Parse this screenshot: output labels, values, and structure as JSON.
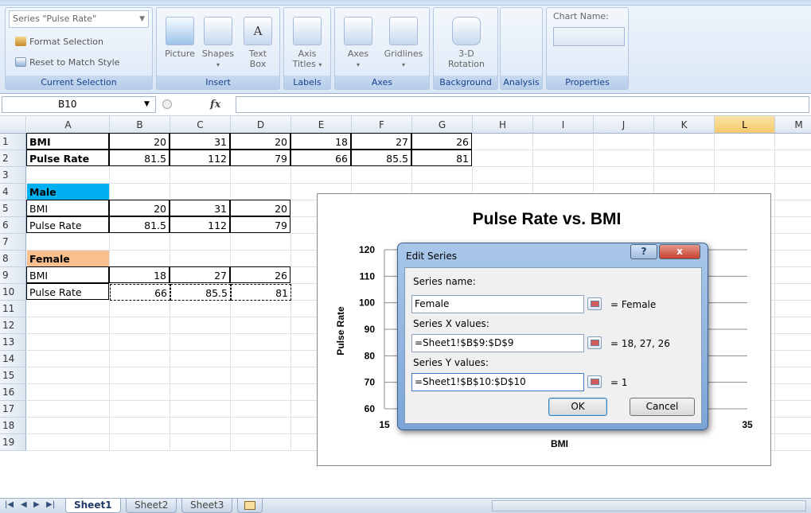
{
  "ribbon": {
    "current_selection": {
      "combo_value": "Series \"Pulse Rate\"",
      "format_selection": "Format Selection",
      "reset_style": "Reset to Match Style",
      "group_label": "Current Selection"
    },
    "insert": {
      "picture": "Picture",
      "shapes": "Shapes",
      "textbox_line1": "Text",
      "textbox_line2": "Box",
      "group_label": "Insert"
    },
    "labels": {
      "axis_titles_line1": "Axis",
      "axis_titles_line2": "Titles",
      "group_label": "Labels"
    },
    "axes": {
      "axes": "Axes",
      "gridlines": "Gridlines",
      "group_label": "Axes"
    },
    "background": {
      "rotation_line1": "3-D",
      "rotation_line2": "Rotation",
      "group_label": "Background"
    },
    "analysis": {
      "group_label": "Analysis"
    },
    "properties": {
      "chart_name_label": "Chart Name:",
      "chart_name_value": "",
      "group_label": "Properties"
    }
  },
  "formula_bar": {
    "name_box": "B10",
    "fx_label": "fx",
    "formula": ""
  },
  "grid": {
    "columns": [
      "A",
      "B",
      "C",
      "D",
      "E",
      "F",
      "G",
      "H",
      "I",
      "J",
      "K",
      "L",
      "M"
    ],
    "rows": [
      "1",
      "2",
      "3",
      "4",
      "5",
      "6",
      "7",
      "8",
      "9",
      "10",
      "11",
      "12",
      "13",
      "14",
      "15",
      "16",
      "17",
      "18",
      "19"
    ],
    "cells": {
      "r1": [
        "BMI",
        "20",
        "31",
        "20",
        "18",
        "27",
        "26"
      ],
      "r2": [
        "Pulse Rate",
        "81.5",
        "112",
        "79",
        "66",
        "85.5",
        "81"
      ],
      "r4": [
        "Male"
      ],
      "r5": [
        "BMI",
        "20",
        "31",
        "20"
      ],
      "r6": [
        "Pulse Rate",
        "81.5",
        "112",
        "79"
      ],
      "r8": [
        "Female"
      ],
      "r9": [
        "BMI",
        "18",
        "27",
        "26"
      ],
      "r10": [
        "Pulse Rate",
        "66",
        "85.5",
        "81"
      ]
    }
  },
  "chart_data": {
    "type": "scatter",
    "title": "Pulse Rate vs. BMI",
    "xlabel": "BMI",
    "ylabel": "Pulse Rate",
    "xlim": [
      15,
      35
    ],
    "ylim": [
      60,
      120
    ],
    "yticks": [
      "120",
      "110",
      "100",
      "90",
      "80",
      "70",
      "60"
    ],
    "xticks": [
      "15",
      "35"
    ],
    "grid": true
  },
  "dialog": {
    "title": "Edit Series",
    "help_label": "?",
    "close_label": "x",
    "series_name_label": "Series name:",
    "series_name_value": "Female",
    "series_name_result": "= Female",
    "x_label": "Series X values:",
    "x_value": "=Sheet1!$B$9:$D$9",
    "x_result": "= 18, 27, 26",
    "y_label": "Series Y values:",
    "y_value": "=Sheet1!$B$10:$D$10",
    "y_result": "= 1",
    "ok": "OK",
    "cancel": "Cancel"
  },
  "sheet_tabs": {
    "tabs": [
      "Sheet1",
      "Sheet2",
      "Sheet3"
    ],
    "active": "Sheet1"
  },
  "colors": {
    "male_header": "#00b0f0",
    "female_header": "#fabf8f",
    "selected_column": "#f4c96b"
  }
}
